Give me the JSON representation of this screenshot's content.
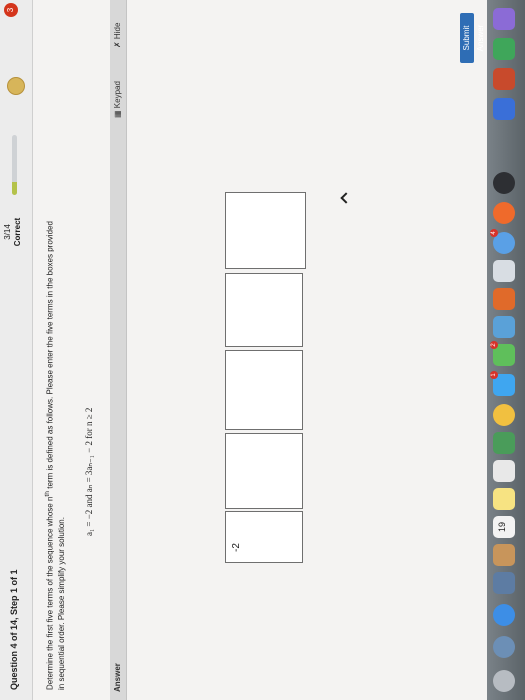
{
  "header": {
    "question_label": "Question 4 of 14, Step 1 of 1",
    "score": "3/14",
    "status": "Correct",
    "progress_fraction": 0.21,
    "notification_count": "3"
  },
  "question": {
    "text_part1": "Determine the first five terms of the sequence whose n",
    "superscript": "th",
    "text_part2": " term is defined as follows. Please enter the five terms in the boxes provided in sequential order. Please simplify your solution.",
    "formula": "a₁ = −2 and aₙ = 3aₙ₋₁ − 2 for n ≥ 2"
  },
  "answer_bar": {
    "label": "Answer",
    "keypad_label": "Keypad",
    "hide_label": "Hide"
  },
  "answers": [
    "-2",
    "",
    "",
    "",
    ""
  ],
  "submit_label": "Submit Answer",
  "dock": {
    "calendar_day": "19",
    "badge_messages": "1",
    "badge_mail": "2",
    "badge_appstore": "4"
  },
  "colors": {
    "accent": "#2e6db5",
    "progress": "#b4c24a",
    "badge": "#d7332a"
  }
}
